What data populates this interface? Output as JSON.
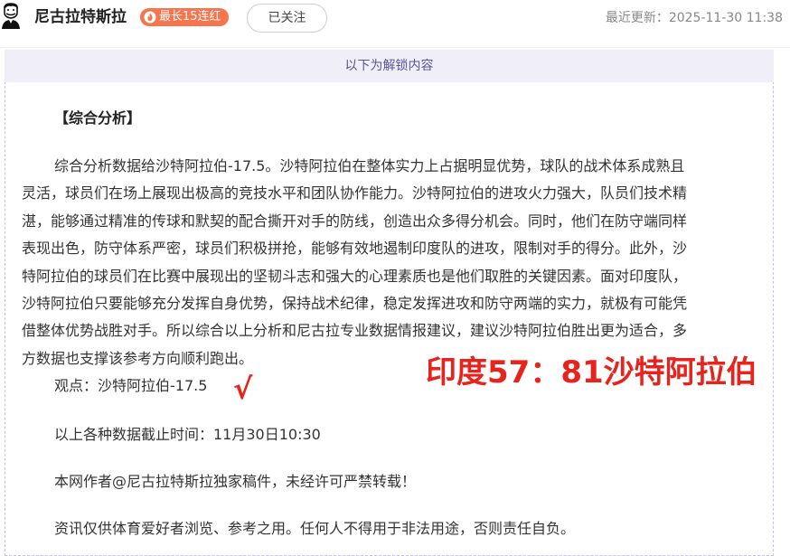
{
  "header": {
    "author_name": "尼古拉特斯拉",
    "streak_badge": "最长15连红",
    "follow_label": "已关注",
    "last_update": "最近更新：2025-11-30 11:38"
  },
  "content": {
    "unlock_banner": "以下为解锁内容",
    "section_title": "【综合分析】",
    "analysis_lines": [
      "综合分析数据给沙特阿拉伯-17.5。沙特阿拉伯在整体实力上占据明显优势，球队的战术体系成熟且",
      "灵活，球员们在场上展现出极高的竞技水平和团队协作能力。沙特阿拉伯的进攻火力强大，队员们技术精",
      "湛，能够通过精准的传球和默契的配合撕开对手的防线，创造出众多得分机会。同时，他们在防守端同样",
      "表现出色，防守体系严密，球员们积极拼抢，能够有效地遏制印度队的进攻，限制对手的得分。此外，沙",
      "特阿拉伯的球员们在比赛中展现出的坚韧斗志和强大的心理素质也是他们取胜的关键因素。面对印度队，",
      "沙特阿拉伯只要能够充分发挥自身优势，保持战术纪律，稳定发挥进攻和防守两端的实力，就极有可能凭",
      "借整体优势战胜对手。所以综合以上分析和尼古拉专业数据情报建议，建议沙特阿拉伯胜出更为适合，多",
      "方数据也支撑该参考方向顺利跑出。"
    ],
    "opinion": "观点：沙特阿拉伯-17.5",
    "check_mark": "√",
    "score_overlay": "印度57：81沙特阿拉伯",
    "cutoff": "以上各种数据截止时间：11月30日10:30",
    "copyright": "本网作者@尼古拉特斯拉独家稿件，未经许可严禁转载！",
    "disclaimer": "资讯仅供体育爱好者浏览、参考之用。任何人不得用于非法用途，否则责任自负。"
  },
  "colors": {
    "badge": "#f7744c",
    "banner_bg": "#f0eff8",
    "banner_text": "#5a529e",
    "highlight_red": "#e8231e"
  }
}
